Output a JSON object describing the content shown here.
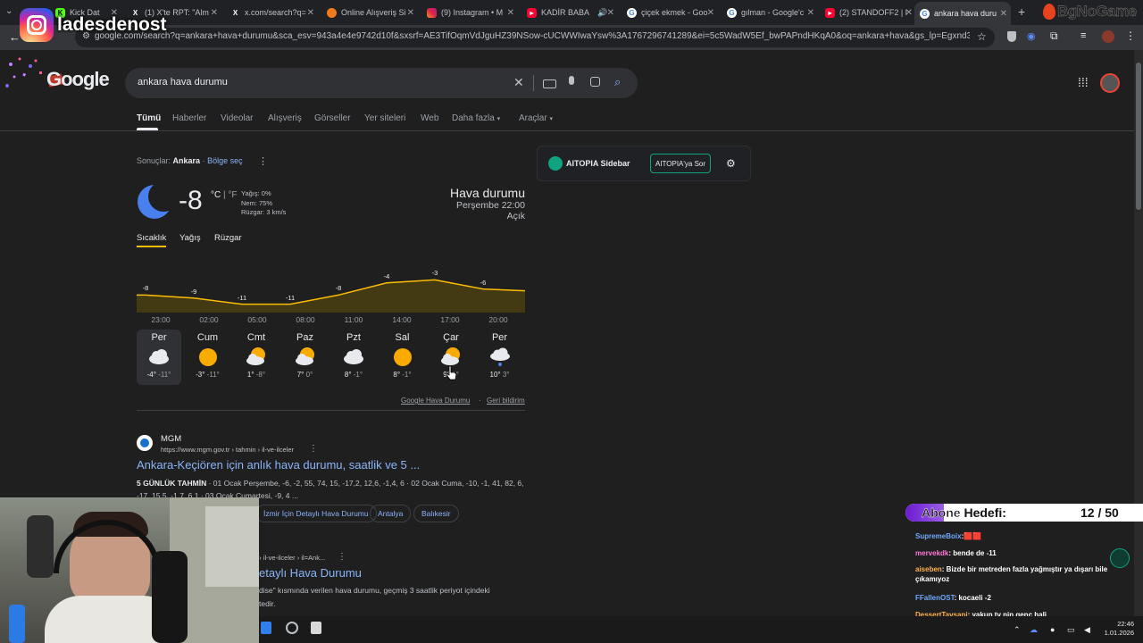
{
  "browser": {
    "tabs": [
      {
        "title": "Kick Dat"
      },
      {
        "title": "(1) X'te RPT: \"Alm"
      },
      {
        "title": "x.com/search?q="
      },
      {
        "title": "Online Alışveriş Si"
      },
      {
        "title": "(9) Instagram • M"
      },
      {
        "title": "KADİR BABA"
      },
      {
        "title": "çiçek ekmek - Goo"
      },
      {
        "title": "gılman - Google'c"
      },
      {
        "title": "(2) STANDOFF2 | I"
      },
      {
        "title": "ankara hava duru"
      }
    ],
    "new_tab": "+",
    "url": "google.com/search?q=ankara+hava+durumu&sca_esv=943a4e4e9742d10f&sxsrf=AE3TifOqmVdJguHZ39NSow-cUCWWIwaYsw%3A1767296741289&ei=5c5WadW5Ef_bwPAPndHKqA0&oq=ankara+hava&gs_lp=Egxnd3Mtd2l6LXNlcnAiC..."
  },
  "overlay": {
    "instagram_handle": "ladesdenost",
    "corner_logo": "BgNoGame",
    "sub_goal_label_1": "Abone",
    "sub_goal_label_2": "Hedefi:",
    "sub_goal_count": "12 / 50",
    "chat": [
      {
        "user": "SupremeBoix",
        "message": ":🟥🟥",
        "user_color": "#6fa8ff"
      },
      {
        "user": "mervekdk",
        "message": ": bende de -11",
        "user_color": "#ff7ad9"
      },
      {
        "user": "aiseben",
        "message": ": Bizde bir metreden fazla yağmıştır ya dışarı bile çıkamıyoz",
        "user_color": "#ffb347"
      },
      {
        "user": "FFallenOST",
        "message": ": kocaeli -2",
        "user_color": "#6fa8ff"
      },
      {
        "user": "DessertTavsani",
        "message": ": yakup tv nin genç hali",
        "user_color": "#ffb347"
      },
      {
        "user": "mervekdk",
        "message": ": eskişehirede bak",
        "user_color": "#ff7ad9"
      }
    ]
  },
  "search": {
    "logo": "Google",
    "query": "ankara hava durumu",
    "tabs": [
      "Tümü",
      "Haberler",
      "Videolar",
      "Alışveriş",
      "Görseller",
      "Yer siteleri",
      "Web",
      "Daha fazla",
      "Araçlar"
    ],
    "active_tab": "Tümü"
  },
  "weather": {
    "results_for_label": "Sonuçlar:",
    "results_for_place": "Ankara",
    "region_link": "Bölge seç",
    "temperature": "-8",
    "unit_c": "°C",
    "unit_sep": "|",
    "unit_f": "°F",
    "precip": "Yağış: 0%",
    "humidity": "Nem: 75%",
    "wind": "Rüzgar: 3 km/s",
    "title": "Hava durumu",
    "datetime": "Perşembe 22:00",
    "condition": "Açık",
    "tabs": [
      "Sıcaklık",
      "Yağış",
      "Rüzgar"
    ],
    "hourly": {
      "temps": [
        -8,
        -9,
        -11,
        -11,
        -8,
        -4,
        -3,
        -6
      ],
      "hours": [
        "23:00",
        "02:00",
        "05:00",
        "08:00",
        "11:00",
        "14:00",
        "17:00",
        "20:00"
      ]
    },
    "days": [
      {
        "name": "Per",
        "hi": "-4°",
        "lo": "-11°",
        "icon": "cloudy-icon"
      },
      {
        "name": "Cum",
        "hi": "-3°",
        "lo": "-11°",
        "icon": "sunny-icon"
      },
      {
        "name": "Cmt",
        "hi": "1°",
        "lo": "-8°",
        "icon": "partly-cloudy-icon"
      },
      {
        "name": "Paz",
        "hi": "7°",
        "lo": "0°",
        "icon": "partly-cloudy-icon"
      },
      {
        "name": "Pzt",
        "hi": "8°",
        "lo": "-1°",
        "icon": "cloudy-icon"
      },
      {
        "name": "Sal",
        "hi": "8°",
        "lo": "-1°",
        "icon": "sunny-icon"
      },
      {
        "name": "Çar",
        "hi": "9°",
        "lo": "1°",
        "icon": "partly-cloudy-icon"
      },
      {
        "name": "Per",
        "hi": "10°",
        "lo": "3°",
        "icon": "rain-icon"
      }
    ],
    "footer_link": "Google Hava Durumu",
    "feedback_link": "Geri bildirim"
  },
  "sidebar_ext": {
    "name": "AITOPIA Sidebar",
    "ask_button": "AITOPIA'ya Sor"
  },
  "results": [
    {
      "site": "MGM",
      "url": "https://www.mgm.gov.tr › tahmin › il-ve-ilceler",
      "title": "Ankara-Keçiören için anlık hava durumu, saatlik ve 5 ...",
      "snippet_bold": "5 GÜNLÜK TAHMİN",
      "snippet": " · 01 Ocak Perşembe, -6, -2, 55, 74, 15, -17,2, 12,6, -1,4, 6 · 02 Ocak Cuma, -10, -1, 41, 82, 6, -17, 15,5, -1,7, 6,1 · 03 Ocak Cumartesi, -9, 4 ...",
      "chips": [
        "İzmir İçin Detaylı Hava Durumu",
        "Antalya",
        "Balıkesir"
      ]
    },
    {
      "url": "n › il-ve-ilceler › il=Ank...",
      "title": "etaylı Hava Durumu",
      "snippet": "dise\" kısmında verilen hava durumu, geçmiş 3 saatlik periyot içindeki",
      "snippet2": "tedir."
    }
  ],
  "taskbar": {
    "time": "22:46",
    "date": "1.01.2026"
  }
}
